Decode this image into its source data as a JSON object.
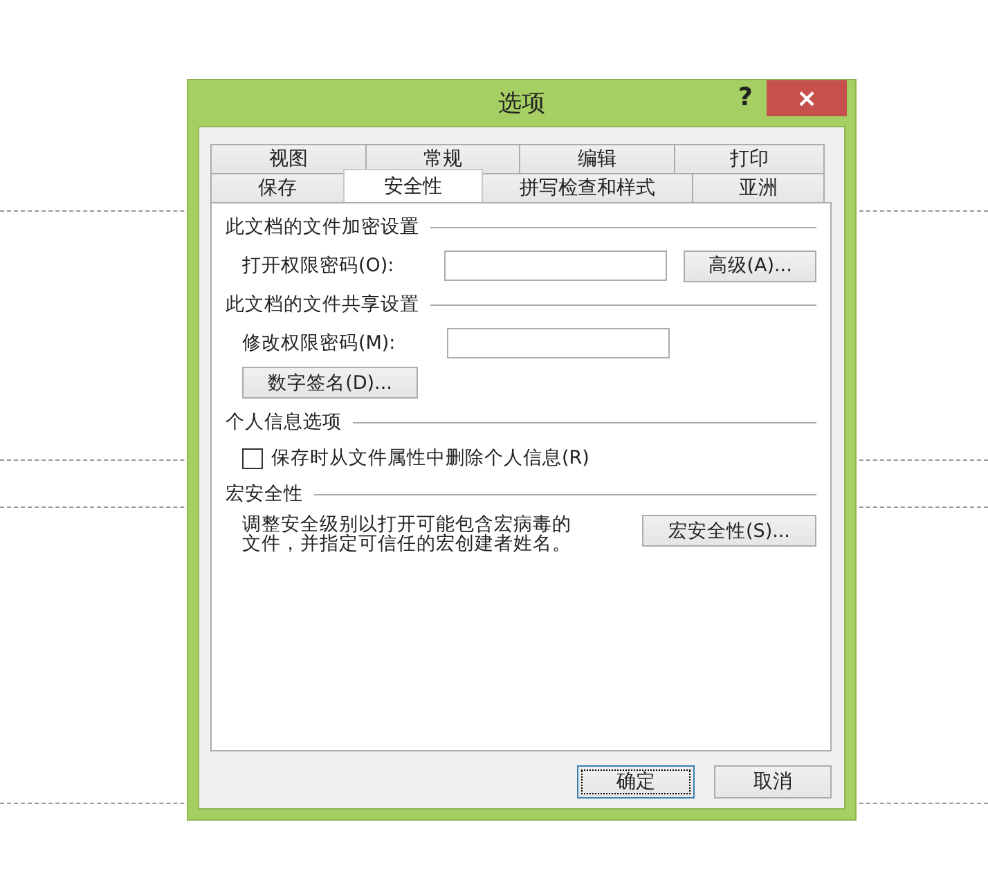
{
  "dialog": {
    "title": "选项",
    "help": "?",
    "close": "×",
    "tab_rows": [
      [
        {
          "label": "视图",
          "selected": false
        },
        {
          "label": "常规",
          "selected": false
        },
        {
          "label": "编辑",
          "selected": false
        },
        {
          "label": "打印",
          "selected": false
        }
      ],
      [
        {
          "label": "保存",
          "selected": false
        },
        {
          "label": "安全性",
          "selected": true
        },
        {
          "label": "拼写检查和样式",
          "selected": false
        },
        {
          "label": "亚洲",
          "selected": false
        }
      ]
    ],
    "sections": [
      {
        "header": "此文档的文件加密设置",
        "rows": [
          {
            "kind": "field",
            "label": "打开权限密码(O):",
            "button": "高级(A)..."
          }
        ]
      },
      {
        "header": "此文档的文件共享设置",
        "rows": [
          {
            "kind": "field",
            "label": "修改权限密码(M):"
          },
          {
            "kind": "button",
            "button": "数字签名(D)..."
          }
        ]
      },
      {
        "header": "个人信息选项",
        "rows": [
          {
            "kind": "checkbox",
            "label": "保存时从文件属性中删除个人信息(R)",
            "checked": false
          }
        ]
      },
      {
        "header": "宏安全性",
        "rows": [
          {
            "kind": "text",
            "text": "调整安全级别以打开可能包含宏病毒的文件，并指定可信任的宏创建者姓名。",
            "button": "宏安全性(S)..."
          }
        ]
      }
    ],
    "buttons": [
      {
        "label": "确定",
        "default": true
      },
      {
        "label": "取消",
        "default": false
      }
    ]
  }
}
